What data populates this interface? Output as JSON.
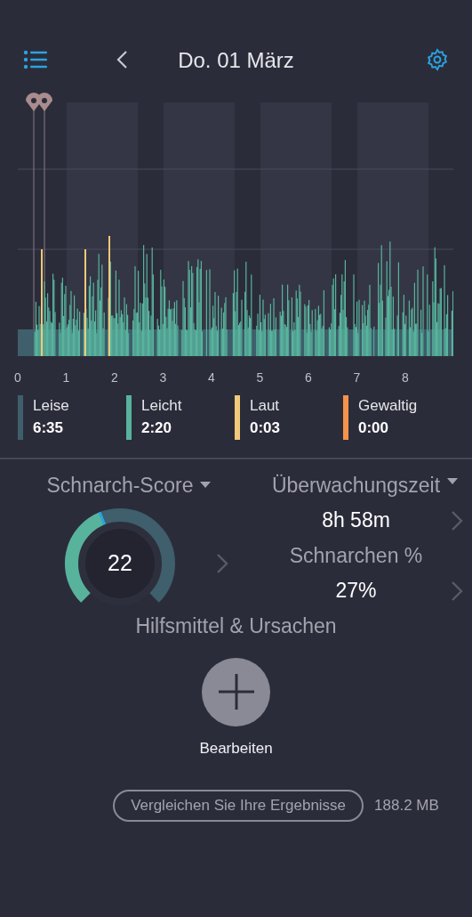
{
  "header": {
    "title": "Do. 01 März"
  },
  "chart": {
    "x_labels": [
      "0",
      "1",
      "2",
      "3",
      "4",
      "5",
      "6",
      "7",
      "8"
    ]
  },
  "legend": [
    {
      "label": "Leise",
      "value": "6:35",
      "color": "#3e5f6b"
    },
    {
      "label": "Leicht",
      "value": "2:20",
      "color": "#58b39d"
    },
    {
      "label": "Laut",
      "value": "0:03",
      "color": "#f0c97a"
    },
    {
      "label": "Gewaltig",
      "value": "0:00",
      "color": "#f59349"
    }
  ],
  "score": {
    "title": "Schnarch-Score",
    "value": "22"
  },
  "stats": [
    {
      "title": "Überwachungszeit",
      "value": "8h 58m",
      "dropdown": true
    },
    {
      "title": "Schnarchen %",
      "value": "27%",
      "dropdown": false
    }
  ],
  "remedies": {
    "title": "Hilfsmittel & Ursachen",
    "button": "Bearbeiten"
  },
  "footer": {
    "compare": "Vergleichen Sie Ihre Ergebnisse",
    "size": "188.2 MB"
  }
}
